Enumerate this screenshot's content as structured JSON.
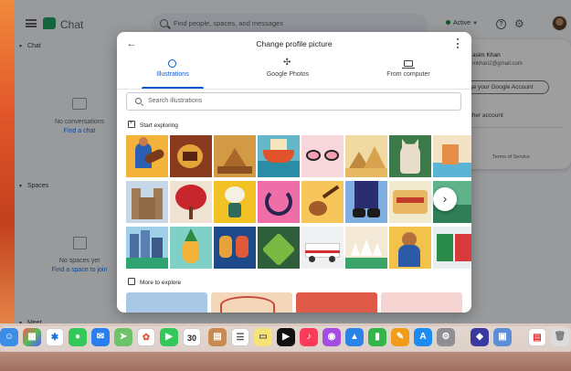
{
  "app": {
    "title": "Chat",
    "search_placeholder": "Find people, spaces, and messages",
    "status": "Active",
    "sidebar": {
      "chat_label": "Chat",
      "spaces_label": "Spaces",
      "more_label": "Meet",
      "no_conversations": "No conversations",
      "find_chat": "Find a chat",
      "no_spaces": "No spaces yet",
      "find_space": "Find a space to join"
    }
  },
  "account_card": {
    "name": "asim Khan",
    "email": "mkhan2@gmail.com",
    "manage_label": "ge your Google Account",
    "other_account": "ther account",
    "privacy": "cy",
    "terms": "Terms of Service"
  },
  "modal": {
    "title": "Change profile picture",
    "tabs": [
      {
        "label": "Illustrations",
        "icon": "palette-icon",
        "active": true
      },
      {
        "label": "Google Photos",
        "icon": "photos-pinwheel-icon",
        "active": false
      },
      {
        "label": "From computer",
        "icon": "computer-icon",
        "active": false
      }
    ],
    "search_placeholder": "Search illustrations",
    "start_exploring": "Start exploring",
    "more_to_explore": "More to explore"
  },
  "colors": {
    "accent": "#0b57d0",
    "chat_green": "#1ea362",
    "active_green": "#1e8e3e"
  },
  "dock": {
    "calendar_day": "30"
  }
}
